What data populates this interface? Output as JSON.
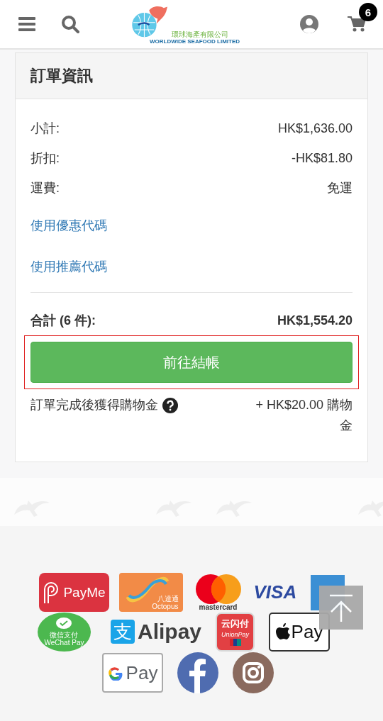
{
  "header": {
    "cart_count": "6",
    "logo": {
      "name_zh": "環球海產有限公司",
      "name_en": "WORLDWIDE SEAFOOD LIMITED"
    }
  },
  "order_summary": {
    "title": "訂單資訊",
    "lines": [
      {
        "label": "小計:",
        "value": "HK$1,636.00"
      },
      {
        "label": "折扣:",
        "value": "-HK$81.80"
      },
      {
        "label": "運費:",
        "value": "免運"
      }
    ],
    "links": [
      "使用優惠代碼",
      "使用推薦代碼"
    ],
    "total": {
      "label": "合計 (6 件):",
      "value": "HK$1,554.20"
    },
    "checkout_button": {
      "label": "前往結帳",
      "highlighted": true
    },
    "reward": {
      "label": "訂單完成後獲得購物金",
      "value": "+ HK$20.00 購物金"
    }
  },
  "footer_rows": [
    [
      {
        "kind": "payme",
        "texts": [
          "PayMe"
        ]
      },
      {
        "kind": "octopus",
        "texts": [
          "八達通",
          "Octopus"
        ]
      },
      {
        "kind": "mastercard",
        "texts": [
          "mastercard"
        ]
      },
      {
        "kind": "visa",
        "texts": [
          "VISA"
        ]
      },
      {
        "kind": "amex"
      }
    ],
    [
      {
        "kind": "wechat",
        "texts": [
          "微信支付",
          "WeChat Pay"
        ]
      },
      {
        "kind": "alipay",
        "texts": [
          "支",
          "Alipay"
        ]
      },
      {
        "kind": "unionpay",
        "texts": [
          "云闪付",
          "UnionPay"
        ]
      },
      {
        "kind": "applepay",
        "texts": [
          "Pay"
        ]
      }
    ],
    [
      {
        "kind": "googlepay",
        "texts": [
          "Pay"
        ]
      },
      {
        "kind": "facebook"
      },
      {
        "kind": "instagram"
      }
    ]
  ]
}
